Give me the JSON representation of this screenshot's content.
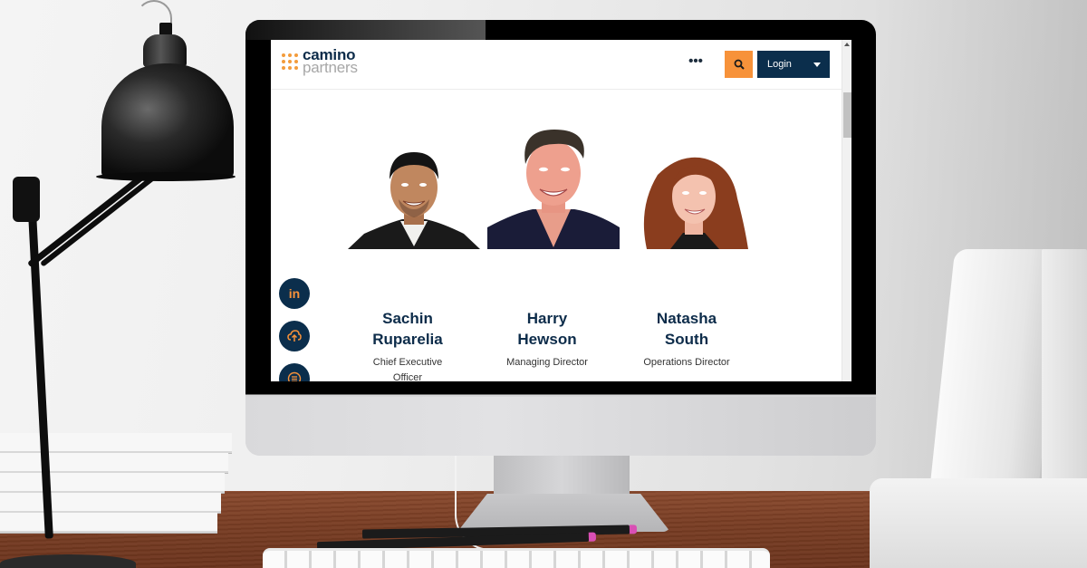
{
  "browser": {
    "logo": {
      "line1": "camino",
      "line2": "partners",
      "accent_color": "#f39c3b",
      "brand_color": "#0d2c4a"
    },
    "header": {
      "more_label": "•••",
      "search_icon": "search-icon",
      "login_label": "Login",
      "login_caret_icon": "caret-down-icon"
    },
    "social_buttons": [
      {
        "icon": "linkedin-icon",
        "label": "in"
      },
      {
        "icon": "cloud-upload-icon"
      },
      {
        "icon": "list-menu-icon"
      }
    ],
    "team": [
      {
        "name_line1": "Sachin",
        "name_line2": "Ruparelia",
        "role_line1": "Chief Executive",
        "role_line2": "Officer"
      },
      {
        "name_line1": "Harry",
        "name_line2": "Hewson",
        "role_line1": "Managing Director",
        "role_line2": ""
      },
      {
        "name_line1": "Natasha",
        "name_line2": "South",
        "role_line1": "Operations Director",
        "role_line2": ""
      }
    ],
    "colors": {
      "orange": "#f7923a",
      "navy": "#0b2e4c"
    }
  }
}
